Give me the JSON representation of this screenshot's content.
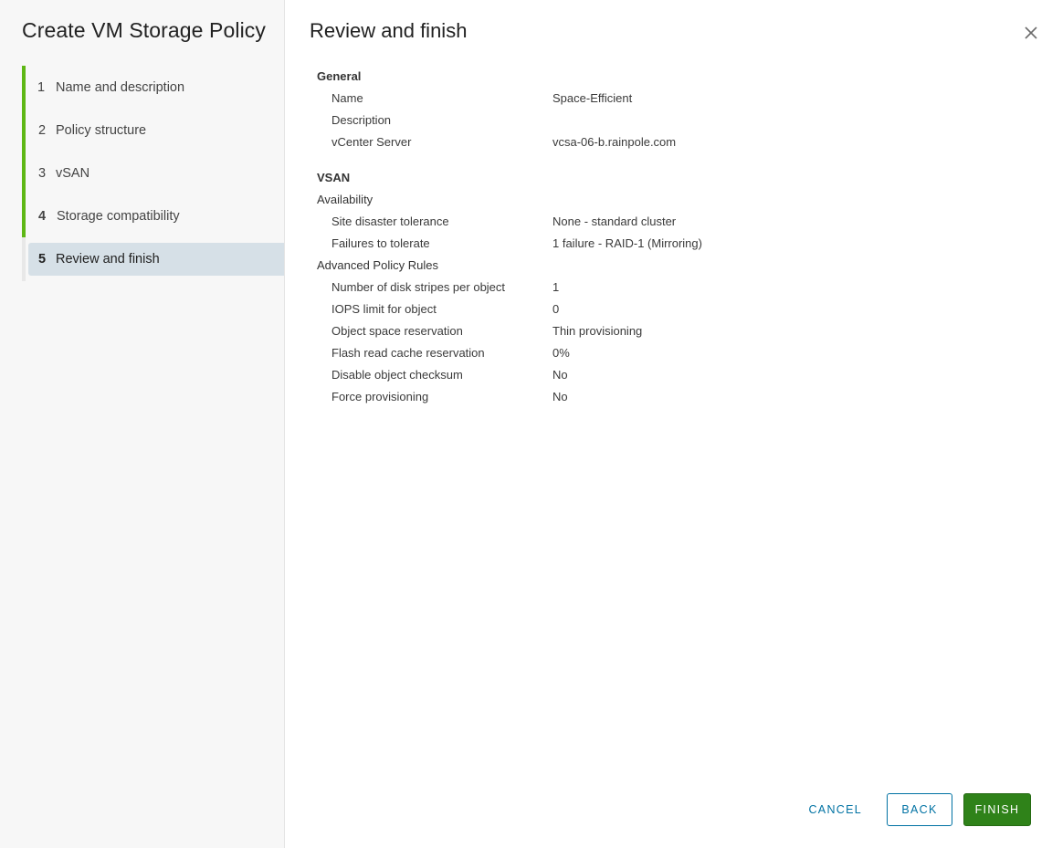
{
  "wizard": {
    "title": "Create VM Storage Policy",
    "steps": [
      {
        "number": "1",
        "label": "Name and description",
        "state": "completed"
      },
      {
        "number": "2",
        "label": "Policy structure",
        "state": "completed"
      },
      {
        "number": "3",
        "label": "vSAN",
        "state": "completed"
      },
      {
        "number": "4",
        "label": "Storage compatibility",
        "state": "completed"
      },
      {
        "number": "5",
        "label": "Review and finish",
        "state": "active"
      }
    ],
    "accent_color": "#5eb715"
  },
  "main": {
    "title": "Review and finish",
    "close_icon": "close-icon",
    "general": {
      "heading": "General",
      "rows": [
        {
          "key": "Name",
          "value": "Space-Efficient"
        },
        {
          "key": "Description",
          "value": ""
        },
        {
          "key": "vCenter Server",
          "value": "vcsa-06-b.rainpole.com"
        }
      ]
    },
    "vsan": {
      "heading": "VSAN",
      "availability": {
        "heading": "Availability",
        "rows": [
          {
            "key": "Site disaster tolerance",
            "value": "None - standard cluster"
          },
          {
            "key": "Failures to tolerate",
            "value": "1 failure - RAID-1 (Mirroring)"
          }
        ]
      },
      "advanced": {
        "heading": "Advanced Policy Rules",
        "rows": [
          {
            "key": "Number of disk stripes per object",
            "value": "1"
          },
          {
            "key": "IOPS limit for object",
            "value": "0"
          },
          {
            "key": "Object space reservation",
            "value": "Thin provisioning"
          },
          {
            "key": "Flash read cache reservation",
            "value": "0%"
          },
          {
            "key": "Disable object checksum",
            "value": "No"
          },
          {
            "key": "Force provisioning",
            "value": "No"
          }
        ]
      }
    }
  },
  "footer": {
    "cancel_label": "CANCEL",
    "back_label": "BACK",
    "finish_label": "FINISH",
    "finish_color": "#2f8219",
    "link_color": "#0072a3"
  }
}
